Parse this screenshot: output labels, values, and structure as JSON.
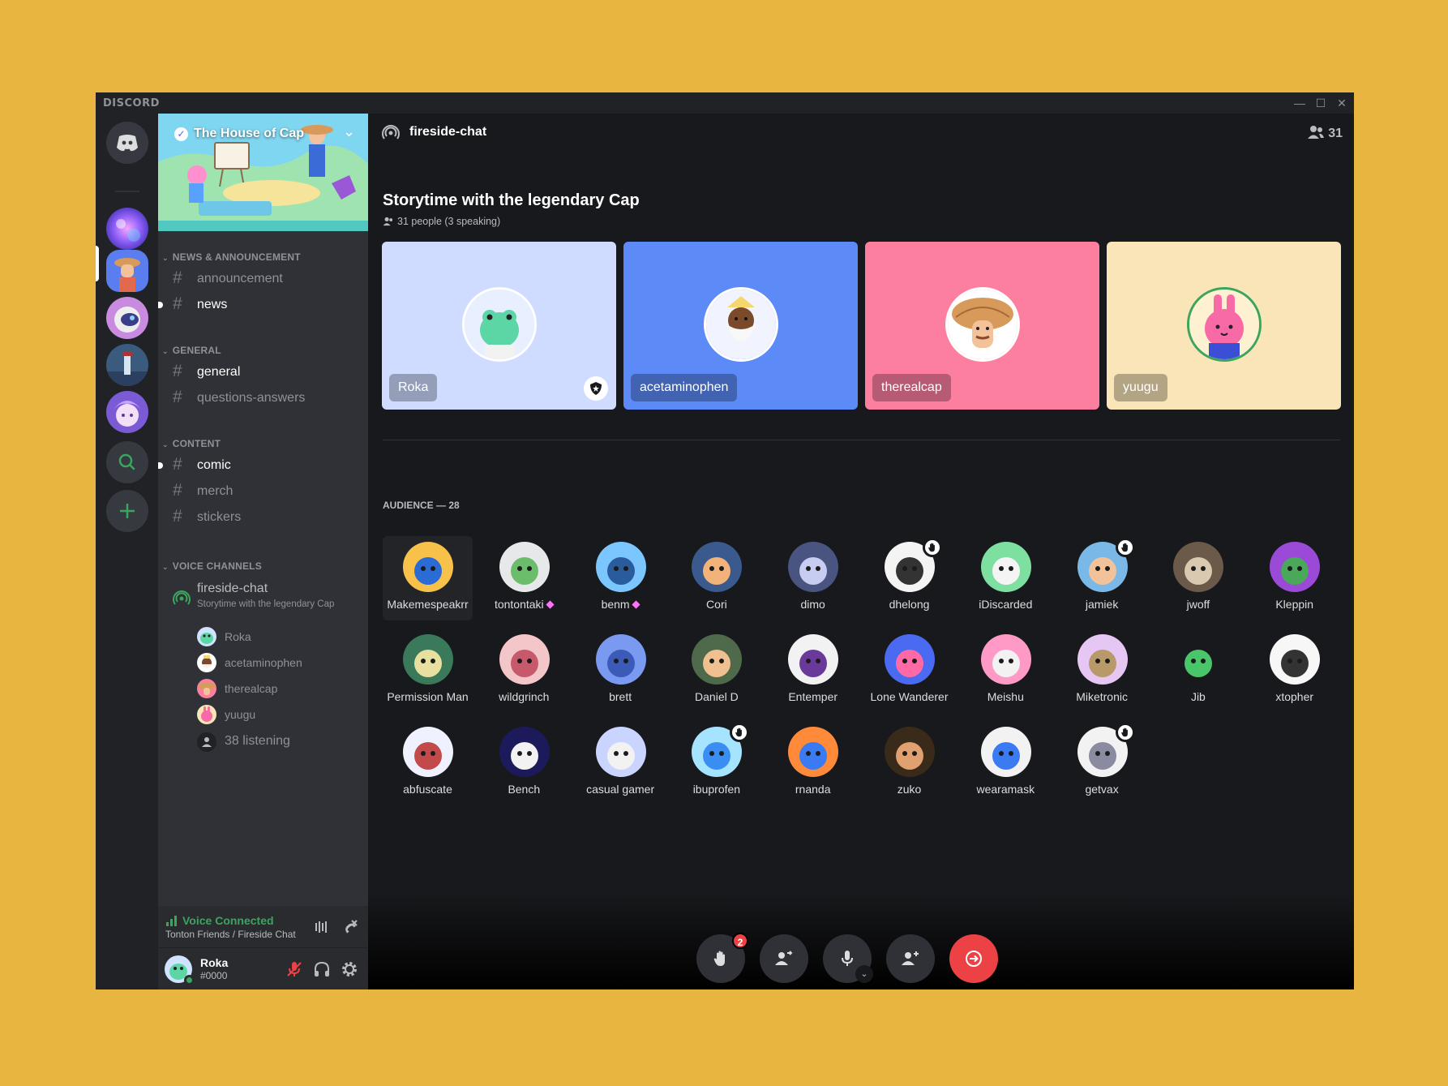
{
  "app": {
    "brand": "DISCORD",
    "window_controls": [
      "—",
      "☐",
      "✕"
    ]
  },
  "colors": {
    "background": "#e8b640",
    "accent": "#5865f2",
    "online": "#3ba55d",
    "danger": "#ed4245"
  },
  "server_rail": {
    "icons": [
      "home-discord-icon",
      "server-nebula",
      "server-house-of-cap",
      "server-astronaut",
      "server-lighthouse",
      "server-anime",
      "explore-icon",
      "add-server-icon"
    ]
  },
  "guild": {
    "name": "The House of Cap",
    "categories": [
      {
        "name": "NEWS & ANNOUNCEMENT",
        "channels": [
          {
            "name": "announcement",
            "unread": false
          },
          {
            "name": "news",
            "unread": true
          }
        ]
      },
      {
        "name": "GENERAL",
        "channels": [
          {
            "name": "general",
            "unread": true
          },
          {
            "name": "questions-answers",
            "unread": false
          }
        ]
      },
      {
        "name": "CONTENT",
        "channels": [
          {
            "name": "comic",
            "unread": true
          },
          {
            "name": "merch",
            "unread": false
          },
          {
            "name": "stickers",
            "unread": false
          }
        ]
      }
    ],
    "voice_category": "VOICE CHANNELS",
    "stage_channel": {
      "name": "fireside-chat",
      "topic": "Storytime with the legendary Cap",
      "users": [
        "Roka",
        "acetaminophen",
        "therealcap",
        "yuugu"
      ],
      "listening": "38 listening"
    }
  },
  "voice_status": {
    "title": "Voice Connected",
    "location": "Tonton Friends / Fireside Chat"
  },
  "user": {
    "name": "Roka",
    "tag": "#0000"
  },
  "stage": {
    "channel": "fireside-chat",
    "member_count": "31",
    "title": "Storytime with the legendary Cap",
    "subtitle": "31 people (3 speaking)",
    "speakers": [
      {
        "name": "Roka",
        "bg": "#cfdcff",
        "moderator": true
      },
      {
        "name": "acetaminophen",
        "bg": "#5c8af7",
        "moderator": false
      },
      {
        "name": "therealcap",
        "bg": "#fc7fa0",
        "moderator": false
      },
      {
        "name": "yuugu",
        "bg": "#f9e5b8",
        "moderator": false
      }
    ],
    "audience_header": "AUDIENCE — 28",
    "audience": [
      {
        "name": "Makemespeakrr",
        "boost": false,
        "hand": false
      },
      {
        "name": "tontontaki",
        "boost": true,
        "hand": false
      },
      {
        "name": "benm",
        "boost": true,
        "hand": false
      },
      {
        "name": "Cori",
        "boost": false,
        "hand": false
      },
      {
        "name": "dimo",
        "boost": false,
        "hand": false
      },
      {
        "name": "dhelong",
        "boost": false,
        "hand": true
      },
      {
        "name": "iDiscarded",
        "boost": false,
        "hand": false
      },
      {
        "name": "jamiek",
        "boost": false,
        "hand": true
      },
      {
        "name": "jwoff",
        "boost": false,
        "hand": false
      },
      {
        "name": "Kleppin",
        "boost": false,
        "hand": false
      },
      {
        "name": "Permission Man",
        "boost": false,
        "hand": false
      },
      {
        "name": "wildgrinch",
        "boost": false,
        "hand": false
      },
      {
        "name": "brett",
        "boost": false,
        "hand": false
      },
      {
        "name": "Daniel D",
        "boost": false,
        "hand": false
      },
      {
        "name": "Entemper",
        "boost": false,
        "hand": false
      },
      {
        "name": "Lone Wanderer",
        "boost": false,
        "hand": false
      },
      {
        "name": "Meishu",
        "boost": false,
        "hand": false
      },
      {
        "name": "Miketronic",
        "boost": false,
        "hand": false
      },
      {
        "name": "Jib",
        "boost": false,
        "hand": false
      },
      {
        "name": "xtopher",
        "boost": false,
        "hand": false
      },
      {
        "name": "abfuscate",
        "boost": false,
        "hand": false
      },
      {
        "name": "Bench",
        "boost": false,
        "hand": false
      },
      {
        "name": "casual gamer",
        "boost": false,
        "hand": false
      },
      {
        "name": "ibuprofen",
        "boost": false,
        "hand": true
      },
      {
        "name": "rnanda",
        "boost": false,
        "hand": false
      },
      {
        "name": "zuko",
        "boost": false,
        "hand": false
      },
      {
        "name": "wearamask",
        "boost": false,
        "hand": false
      },
      {
        "name": "getvax",
        "boost": false,
        "hand": true
      }
    ],
    "controls": {
      "hand_requests": "2"
    }
  }
}
